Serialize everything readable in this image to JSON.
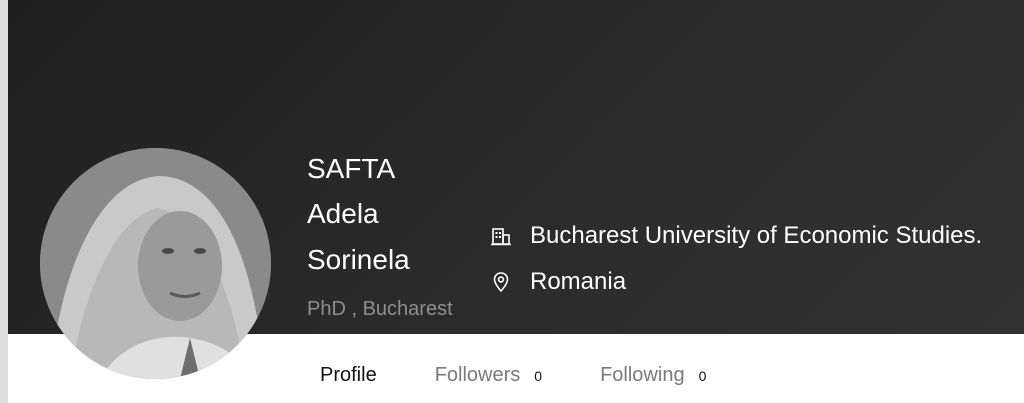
{
  "profile": {
    "name_lines": [
      "SAFTA",
      "Adela",
      "Sorinela"
    ],
    "subtitle": "PhD , Bucharest",
    "avatar_icon": "profile-photo",
    "organization": "Bucharest University of Economic Studies.",
    "organization_icon": "building-icon",
    "location": "Romania",
    "location_icon": "location-pin-icon"
  },
  "tabs": [
    {
      "label": "Profile",
      "count": null,
      "active": true
    },
    {
      "label": "Followers",
      "count": "0",
      "active": false
    },
    {
      "label": "Following",
      "count": "0",
      "active": false
    }
  ],
  "colors": {
    "banner": "#2a2a2a",
    "text_on_banner": "#ffffff",
    "muted": "#8e8e8e",
    "tab_inactive": "#7a7a7a"
  }
}
